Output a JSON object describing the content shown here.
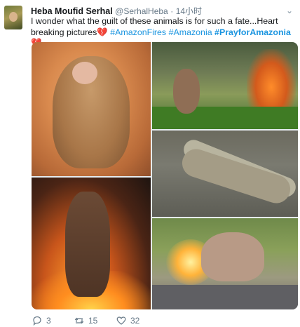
{
  "tweet": {
    "author_name": "Heba Moufid Serhal",
    "handle": "@SerhalHeba",
    "separator": "·",
    "time": "14小时",
    "text_line1": "I wonder what the guilt of these animals is for such a fate...Heart",
    "text_line2_prefix": "breaking pictures",
    "hashtags": {
      "amazonfires": "#AmazonFires",
      "amazonia": "#Amazonia",
      "prayforamazonia": "#PrayforAmazonia"
    },
    "emoji_broken_heart": "💔"
  },
  "icons": {
    "caret": "chevron-down-icon",
    "reply": "reply-icon",
    "retweet": "retweet-icon",
    "like": "heart-icon"
  },
  "actions": {
    "replies": "3",
    "retweets": "15",
    "likes": "32"
  },
  "colors": {
    "link": "#1b95e0",
    "muted": "#657786",
    "heart": "#e0245e"
  }
}
